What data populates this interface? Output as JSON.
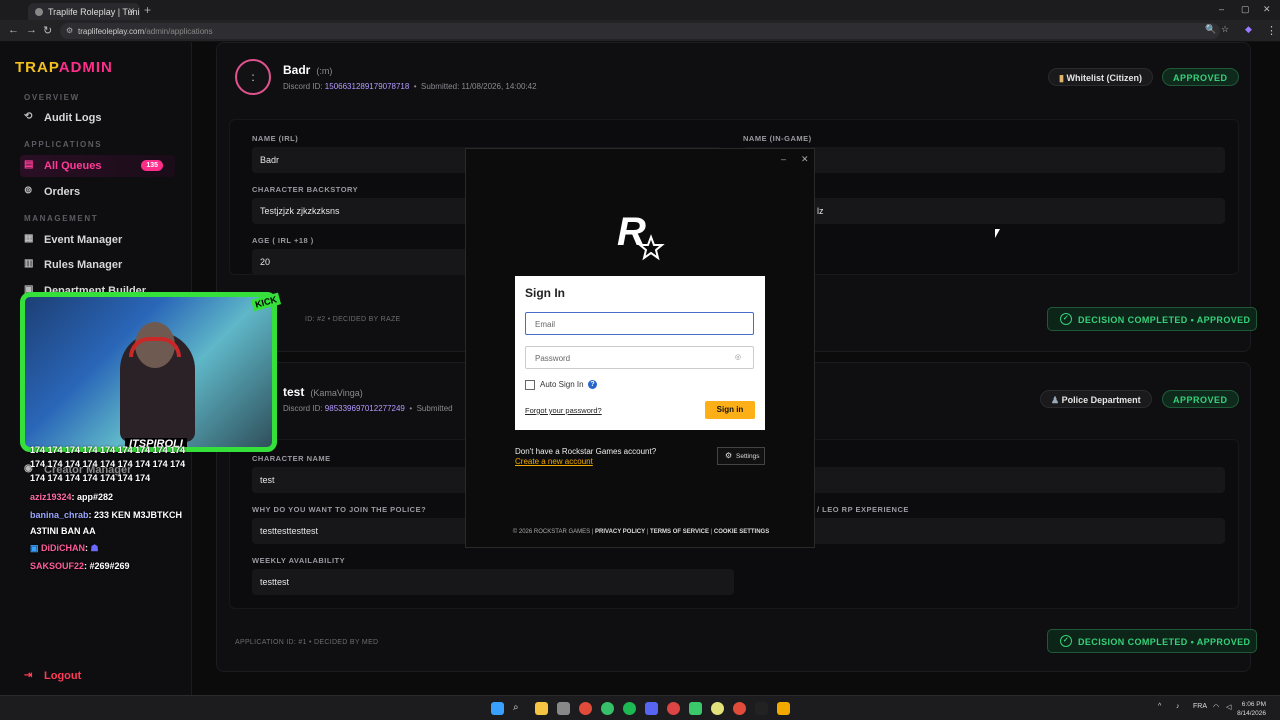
{
  "browser": {
    "tab_title": "Traplife Roleplay | Tunisian GTA",
    "new_tab": "+",
    "url_domain": "traplifeoleplay.com",
    "url_path": "/admin/applications",
    "controls": {
      "min": "–",
      "max": "▢",
      "close": "✕"
    }
  },
  "sidebar": {
    "brand_a": "TRAP",
    "brand_b": "ADMIN",
    "sections": {
      "overview": "OVERVIEW",
      "applications": "APPLICATIONS",
      "management": "MANAGEMENT"
    },
    "items": {
      "audit_logs": "Audit Logs",
      "all_queues": "All Queues",
      "all_queues_count": "135",
      "orders": "Orders",
      "event_manager": "Event Manager",
      "rules_manager": "Rules Manager",
      "department_builder": "Department Builder",
      "creator_manager": "Creator Manager"
    },
    "logout": "Logout"
  },
  "applications": [
    {
      "avatar": ":",
      "name": "Badr",
      "alias": "(:m)",
      "discord_label": "Discord ID:",
      "discord_id": "1506631289179078718",
      "submitted": "Submitted: 11/08/2026, 14:00:42",
      "type": "Whitelist (Citizen)",
      "status": "APPROVED",
      "fields": [
        {
          "label": "NAME (IRL)",
          "value": "Badr"
        },
        {
          "label": "NAME (IN-GAME)",
          "value": ""
        },
        {
          "label": "CHARACTER BACKSTORY",
          "value": "Testjzjzk zjkzkzksns"
        },
        {
          "label": "",
          "value": "lz"
        },
        {
          "label": "AGE ( IRL +18 )",
          "value": "20"
        }
      ],
      "footer": "ID: #2 • DECIDED BY RAZE",
      "decision": "DECISION COMPLETED • APPROVED"
    },
    {
      "name": "test",
      "alias": "(KamaVinga)",
      "discord_label": "Discord ID:",
      "discord_id": "985339697012277249",
      "submitted": "Submitted",
      "type": "Police Department",
      "status": "APPROVED",
      "fields": [
        {
          "label": "CHARACTER NAME",
          "value": "test"
        },
        {
          "label": "WHY DO YOU WANT TO JOIN THE POLICE?",
          "value": "testtesttesttest"
        },
        {
          "label": "/ LEO RP EXPERIENCE",
          "value": ""
        },
        {
          "label": "WEEKLY AVAILABILITY",
          "value": "testtest"
        }
      ],
      "footer": "APPLICATION ID: #1 • DECIDED BY MED",
      "decision": "DECISION COMPLETED • APPROVED"
    }
  ],
  "rockstar": {
    "title": "Sign In",
    "email_placeholder": "Email",
    "password_placeholder": "Password",
    "auto_sign_in": "Auto Sign In",
    "help": "?",
    "forgot": "Forgot your password?",
    "sign_in_button": "Sign in",
    "no_account": "Don't have a Rockstar Games account?",
    "create_account": "Create a new account",
    "settings": "Settings",
    "footer_copy": "© 2026 ROCKSTAR GAMES | ",
    "privacy": "PRIVACY POLICY",
    "terms": "TERMS OF SERVICE",
    "cookies": "COOKIE SETTINGS",
    "sep": " | "
  },
  "stream": {
    "streamer": "ITSPIROLI",
    "kick": "KICK",
    "chat": [
      {
        "user": "",
        "msg": "174 174 174 174 174 174 174 174 174"
      },
      {
        "user": "",
        "msg": "174 174 174 174 174 174 174 174 174"
      },
      {
        "user": "",
        "msg": "174 174 174 174 174 174 174"
      },
      {
        "user": "aziz19324",
        "msg": ": app#282"
      },
      {
        "user": "banina_chrab",
        "msg": ": 233 KEN M3JBTKCH"
      },
      {
        "user": "",
        "msg": "A3TINI BAN AA"
      },
      {
        "user": "DiDiCHAN",
        "msg": ":"
      },
      {
        "user": "SAKSOUF22",
        "msg": ": #269#269"
      }
    ]
  },
  "taskbar": {
    "lang": "FRA",
    "time": "6:06 PM",
    "date": "8/14/2026"
  }
}
